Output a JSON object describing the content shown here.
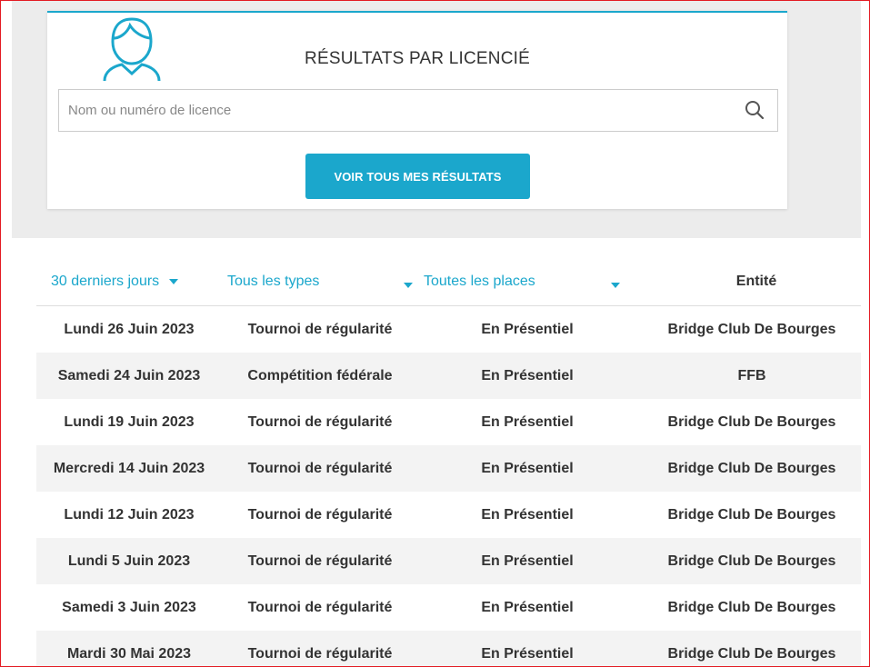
{
  "card": {
    "title": "RÉSULTATS PAR LICENCIÉ",
    "search_placeholder": "Nom ou numéro de licence",
    "button_label": "VOIR TOUS MES RÉSULTATS"
  },
  "icons": {
    "avatar": "user-avatar-icon",
    "search": "search-icon",
    "dropdown": "caret-down-icon"
  },
  "colors": {
    "accent": "#1ba7cc",
    "text": "#333333",
    "panel_bg": "#ececec",
    "frame": "#e31b23"
  },
  "filters": {
    "period": "30 derniers jours",
    "type": "Tous les types",
    "place": "Toutes les places",
    "entity_header": "Entité"
  },
  "results": [
    {
      "date": "Lundi 26 Juin 2023",
      "type": "Tournoi de régularité",
      "place": "En Présentiel",
      "entity": "Bridge Club De Bourges"
    },
    {
      "date": "Samedi 24 Juin 2023",
      "type": "Compétition fédérale",
      "place": "En Présentiel",
      "entity": "FFB"
    },
    {
      "date": "Lundi 19 Juin 2023",
      "type": "Tournoi de régularité",
      "place": "En Présentiel",
      "entity": "Bridge Club De Bourges"
    },
    {
      "date": "Mercredi 14 Juin 2023",
      "type": "Tournoi de régularité",
      "place": "En Présentiel",
      "entity": "Bridge Club De Bourges"
    },
    {
      "date": "Lundi 12 Juin 2023",
      "type": "Tournoi de régularité",
      "place": "En Présentiel",
      "entity": "Bridge Club De Bourges"
    },
    {
      "date": "Lundi 5 Juin 2023",
      "type": "Tournoi de régularité",
      "place": "En Présentiel",
      "entity": "Bridge Club De Bourges"
    },
    {
      "date": "Samedi 3 Juin 2023",
      "type": "Tournoi de régularité",
      "place": "En Présentiel",
      "entity": "Bridge Club De Bourges"
    },
    {
      "date": "Mardi 30 Mai 2023",
      "type": "Tournoi de régularité",
      "place": "En Présentiel",
      "entity": "Bridge Club De Bourges"
    }
  ]
}
